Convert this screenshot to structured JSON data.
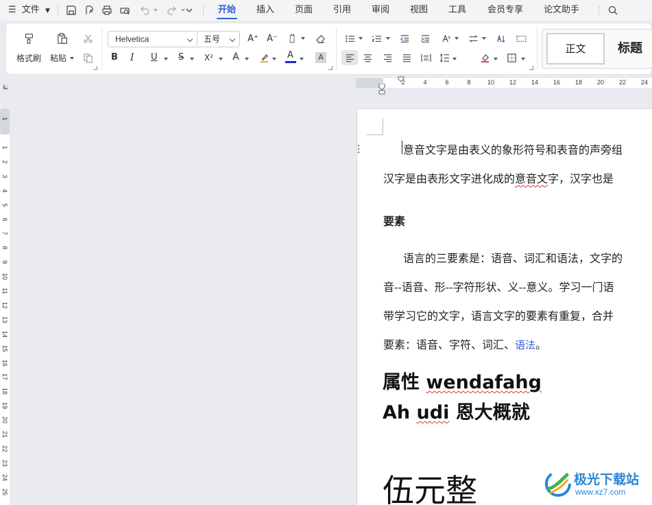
{
  "menubar": {
    "menu_icon": "hamburger-icon",
    "file_label": "文件",
    "tabs": [
      {
        "label": "开始",
        "active": true
      },
      {
        "label": "插入",
        "active": false
      },
      {
        "label": "页面",
        "active": false
      },
      {
        "label": "引用",
        "active": false
      },
      {
        "label": "审阅",
        "active": false
      },
      {
        "label": "视图",
        "active": false
      },
      {
        "label": "工具",
        "active": false
      },
      {
        "label": "会员专享",
        "active": false
      },
      {
        "label": "论文助手",
        "active": false
      }
    ],
    "accent_color": "#2b5fd9"
  },
  "ribbon": {
    "format_painter_label": "格式刷",
    "paste_label": "粘贴",
    "font_name": "Helvetica",
    "font_size": "五号",
    "bold_label": "B",
    "italic_label": "I",
    "underline_label": "U",
    "strike_label": "S",
    "superscript_label": "X²",
    "font_effect_label": "A",
    "font_color_label": "A",
    "char_shade_label": "A",
    "grow_label": "A⁺",
    "shrink_label": "A⁻",
    "styles": {
      "normal": "正文",
      "heading": "标题"
    }
  },
  "rulers": {
    "horizontal_ticks": [
      "2",
      "4",
      "6",
      "8",
      "10",
      "12",
      "14",
      "16",
      "18",
      "20",
      "22",
      "24"
    ],
    "vertical_ticks": [
      "1",
      "1",
      "2",
      "3",
      "4",
      "5",
      "6",
      "7",
      "8",
      "9",
      "10",
      "11",
      "12",
      "13",
      "14",
      "15",
      "16",
      "17",
      "18",
      "19",
      "20",
      "21",
      "22",
      "23",
      "24",
      "25"
    ]
  },
  "document": {
    "line1": "意音文字是由表义的象形符号和表音的声旁组",
    "line2_a": "汉字是由表形文字进化成的",
    "line2_squig": "意音文",
    "line2_b": "字，汉字也是",
    "heading": "要素",
    "p2_line1": "语言的三要素是：语音、词汇和语法，文字的",
    "p2_line2": "音--语音、形--字符形状、义--意义。学习一门语",
    "p2_line3": "带学习它的文字，语言文字的要素有重复，合并",
    "p2_line4_a": "要素：语音、字符、词汇、",
    "p2_line4_link": "语法",
    "p2_line4_b": "。",
    "big1_a": "属性 ",
    "big1_b": "wendafahg",
    "big2_a": "Ah ",
    "big2_b": "udi",
    "big2_c": " 恩大概就",
    "big3": "伍元整"
  },
  "watermark": {
    "title": "极光下载站",
    "url": "www.xz7.com"
  }
}
